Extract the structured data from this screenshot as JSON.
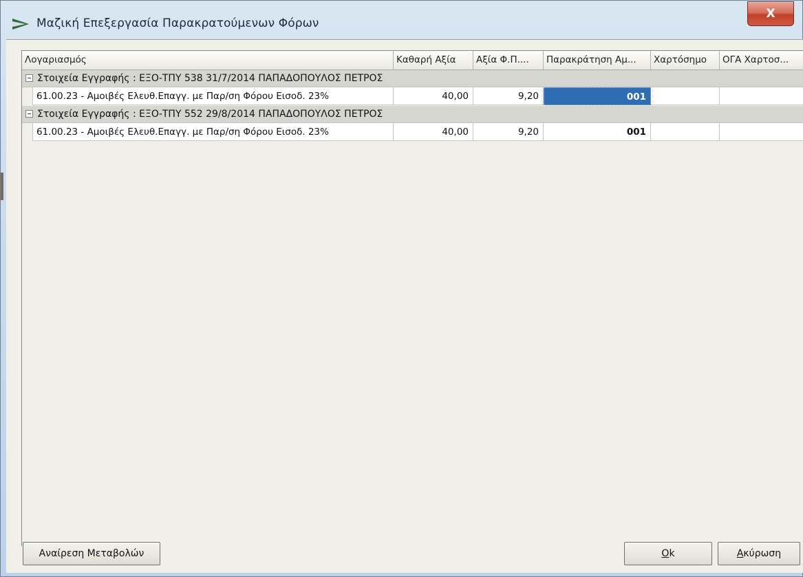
{
  "window": {
    "title": "Μαζική Επεξεργασία Παρακρατούμενων Φόρων",
    "close_label": "X"
  },
  "grid": {
    "columns": [
      {
        "label": "Λογαριασμός"
      },
      {
        "label": "Καθαρή Αξία"
      },
      {
        "label": "Αξία Φ.Π...."
      },
      {
        "label": "Παρακράτηση Αμ..."
      },
      {
        "label": "Χαρτόσημο"
      },
      {
        "label": "ΟΓΑ Χαρτοσ..."
      }
    ],
    "groups": [
      {
        "label": "Στοιχεία Εγγραφής : ΕΞΟ-ΤΠΥ 538 31/7/2014 ΠΑΠΑΔΟΠΟΥΛΟΣ ΠΕΤΡΟΣ",
        "row": {
          "account": "61.00.23 - Αμοιβές Ελευθ.Επαγγ. με Παρ/ση Φόρου Εισοδ.  23%",
          "net_value": "40,00",
          "tax_value": "9,20",
          "withholding": "001",
          "stamp": "",
          "oga_stamp": ""
        }
      },
      {
        "label": "Στοιχεία Εγγραφής : ΕΞΟ-ΤΠΥ 552 29/8/2014 ΠΑΠΑΔΟΠΟΥΛΟΣ ΠΕΤΡΟΣ",
        "row": {
          "account": "61.00.23 - Αμοιβές Ελευθ.Επαγγ. με Παρ/ση Φόρου Εισοδ.  23%",
          "net_value": "40,00",
          "tax_value": "9,20",
          "withholding": "001",
          "stamp": "",
          "oga_stamp": ""
        }
      }
    ]
  },
  "buttons": {
    "revert_label": "Αναίρεση Μεταβολών",
    "ok_underlined": "O",
    "ok_rest": "k",
    "cancel_underlined": "Α",
    "cancel_rest": "κύρωση"
  },
  "colors": {
    "selection": "#2f6db3",
    "group_background": "#d6d6d1",
    "close_button": "#c0412a"
  }
}
